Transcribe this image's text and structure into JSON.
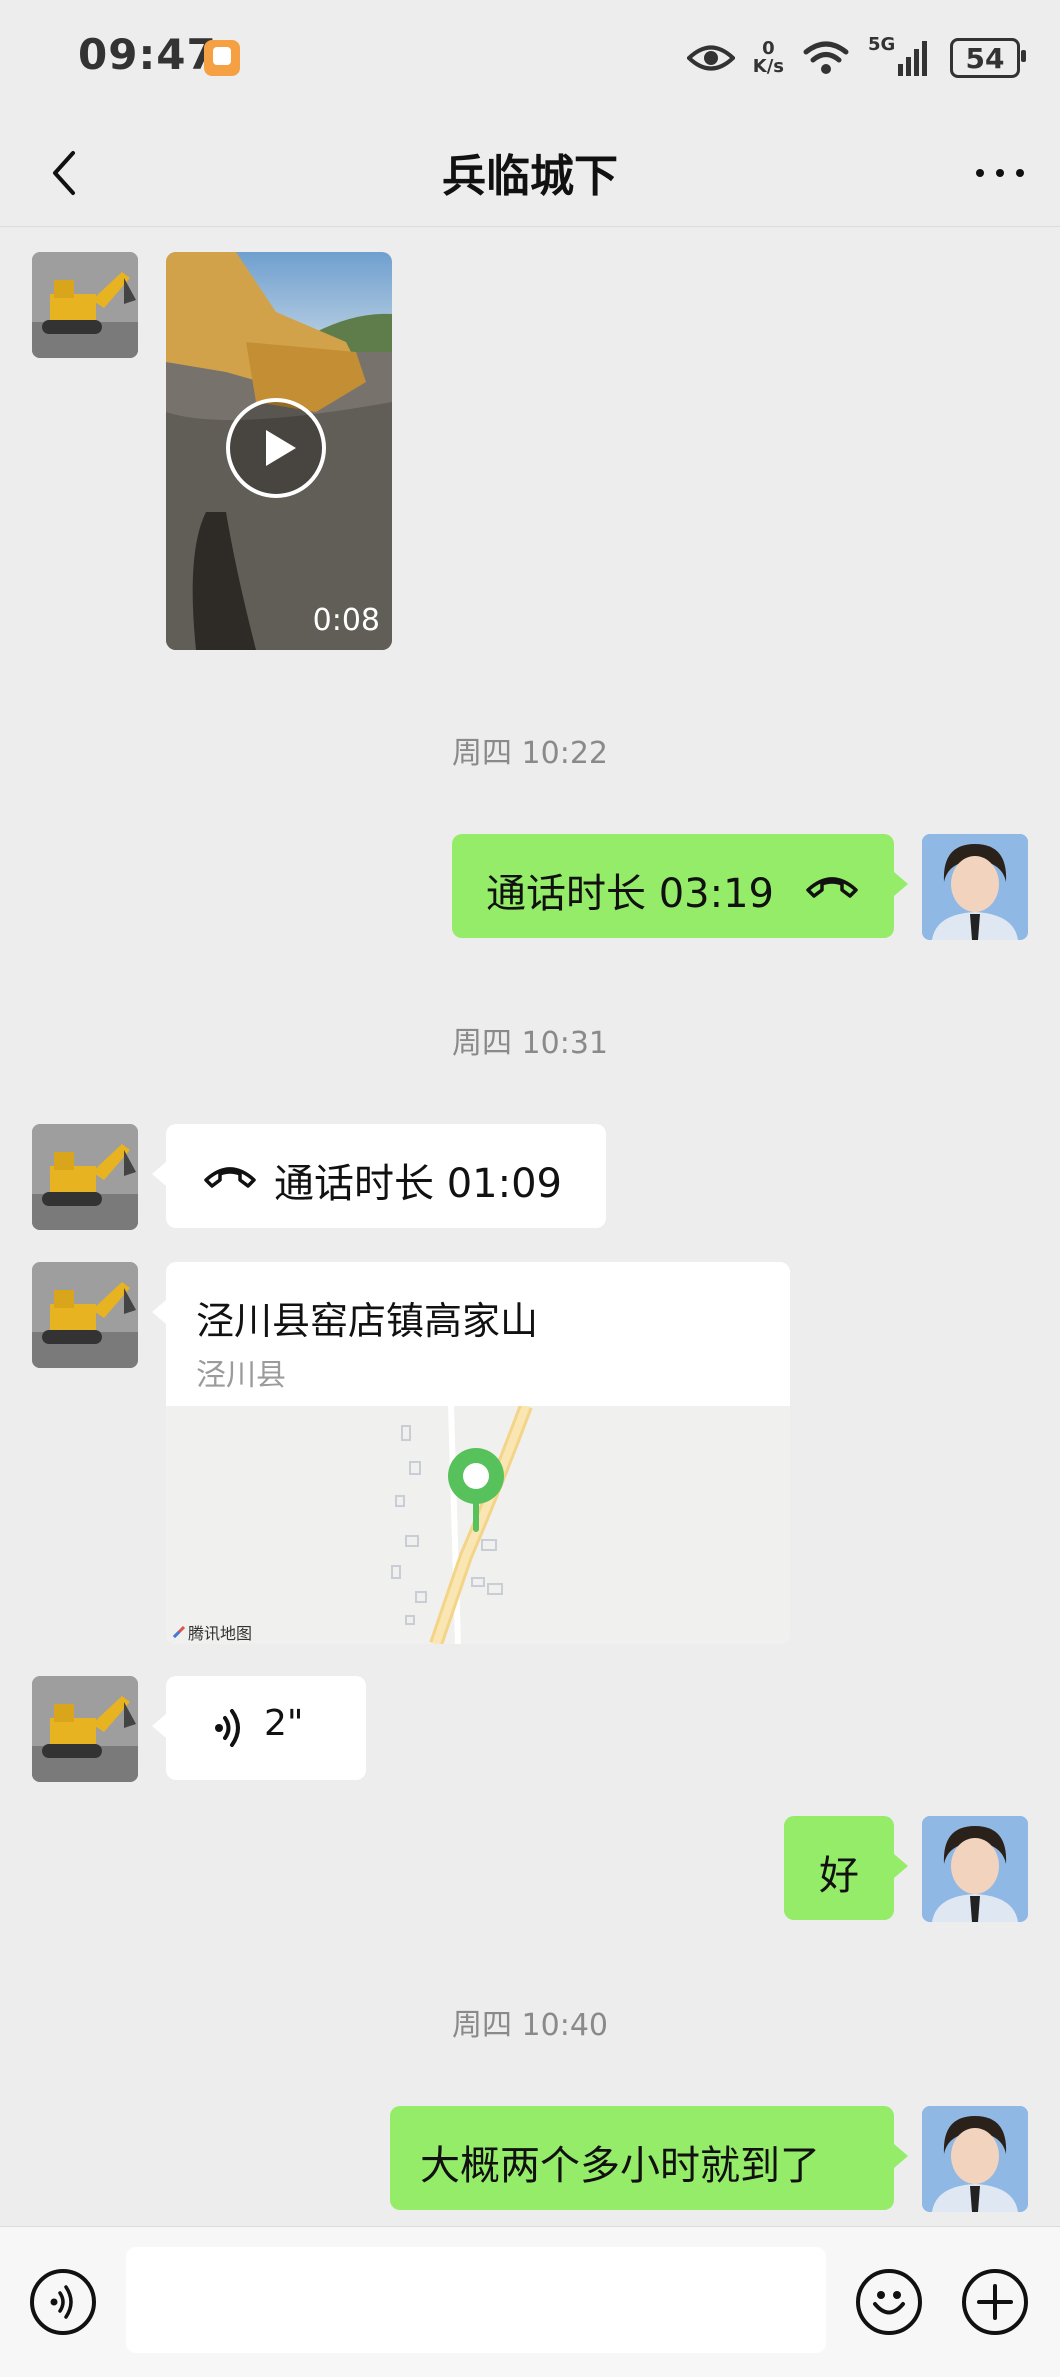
{
  "status_bar": {
    "time": "09:47",
    "net_speed_value": "0",
    "net_speed_unit": "K/s",
    "network": "5G",
    "battery": "54"
  },
  "header": {
    "title": "兵临城下"
  },
  "messages": {
    "video_duration": "0:08",
    "timestamp_1": "周四 10:22",
    "call_out_text": "通话时长 03:19",
    "timestamp_2": "周四 10:31",
    "call_in_text": "通话时长 01:09",
    "location_title": "泾川县窑店镇高家山",
    "location_subtitle": "泾川县",
    "map_attribution": "腾讯地图",
    "voice_duration": "2\"",
    "reply_ok": "好",
    "timestamp_3": "周四 10:40",
    "reply_eta": "大概两个多小时就到了"
  },
  "colors": {
    "background": "#ededed",
    "sent_bubble": "#95ec69",
    "received_bubble": "#ffffff",
    "pin": "#57c15c"
  }
}
